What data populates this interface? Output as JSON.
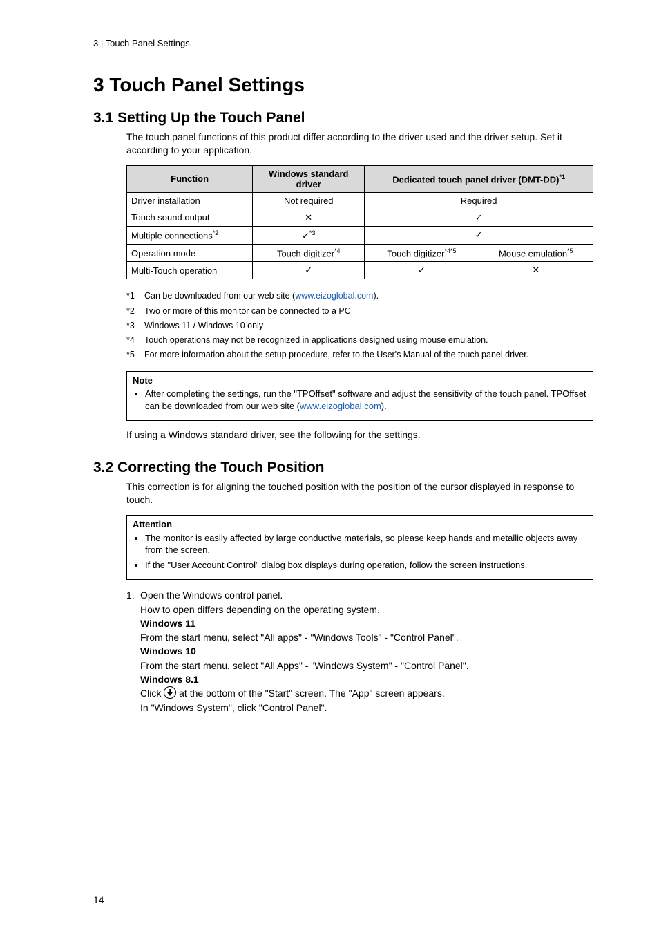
{
  "running_head": "3 | Touch Panel Settings",
  "h1": "3 Touch Panel Settings",
  "s31": {
    "title": "3.1 Setting Up the Touch Panel",
    "intro": "The touch panel functions of this product differ according to the driver used and the driver setup. Set it according to your application.",
    "table": {
      "head": {
        "c1": "Function",
        "c2": "Windows standard driver",
        "c3": "Dedicated touch panel driver (DMT-DD)",
        "c3_sup": "*1"
      },
      "rows": {
        "r1": {
          "c1": "Driver installation",
          "c2": "Not required",
          "c3": "Required"
        },
        "r2": {
          "c1": "Touch sound output",
          "c2": "✕",
          "c3": "✓"
        },
        "r3": {
          "c1": "Multiple connections",
          "c1_sup": "*2",
          "c2": "✓",
          "c2_sup": "*3",
          "c3": "✓"
        },
        "r4": {
          "c1": "Operation mode",
          "c2": "Touch digitizer",
          "c2_sup": "*4",
          "c3a": "Touch digitizer",
          "c3a_sup": "*4*5",
          "c3b": "Mouse emulation",
          "c3b_sup": "*5"
        },
        "r5": {
          "c1": "Multi-Touch operation",
          "c2": "✓",
          "c3a": "✓",
          "c3b": "✕"
        }
      }
    },
    "footnotes": {
      "f1": {
        "mark": "*1",
        "pre": "Can be downloaded from our web site (",
        "link": "www.eizoglobal.com",
        "post": ")."
      },
      "f2": {
        "mark": "*2",
        "text": "Two or more of this monitor can be connected to a PC"
      },
      "f3": {
        "mark": "*3",
        "text": "Windows 11 / Windows 10 only"
      },
      "f4": {
        "mark": "*4",
        "text": "Touch operations may not be recognized in applications designed using mouse emulation."
      },
      "f5": {
        "mark": "*5",
        "text": "For more information about the setup procedure, refer to the User's Manual of the touch panel driver."
      }
    },
    "note": {
      "head": "Note",
      "pre": "After completing the settings, run the \"TPOffset\" software and adjust the sensitivity of the touch panel. TPOffset can be downloaded from our web site (",
      "link": "www.eizoglobal.com",
      "post": ")."
    },
    "after": "If using a Windows standard driver, see the following for the settings."
  },
  "s32": {
    "title": "3.2 Correcting the Touch Position",
    "intro": "This correction is for aligning the touched position with the position of the cursor displayed in response to touch.",
    "attention": {
      "head": "Attention",
      "b1": "The monitor is easily affected by large conductive materials, so please keep hands and metallic objects away from the screen.",
      "b2": "If the \"User Account Control\" dialog box displays during operation, follow the screen instructions."
    },
    "steps": {
      "num": "1.",
      "l1": "Open the Windows control panel.",
      "l2": "How to open differs depending on the operating system.",
      "w11_h": "Windows 11",
      "w11_t": "From the start menu, select \"All apps\" - \"Windows Tools\" - \"Control Panel\".",
      "w10_h": "Windows 10",
      "w10_t": "From the start menu, select \"All Apps\" - \"Windows System\" - \"Control Panel\".",
      "w81_h": "Windows 8.1",
      "w81_t1a": "Click ",
      "w81_t1b": " at the bottom of the \"Start\" screen. The \"App\" screen appears.",
      "w81_t2": "In \"Windows System\", click \"Control Panel\"."
    }
  },
  "page_number": "14"
}
